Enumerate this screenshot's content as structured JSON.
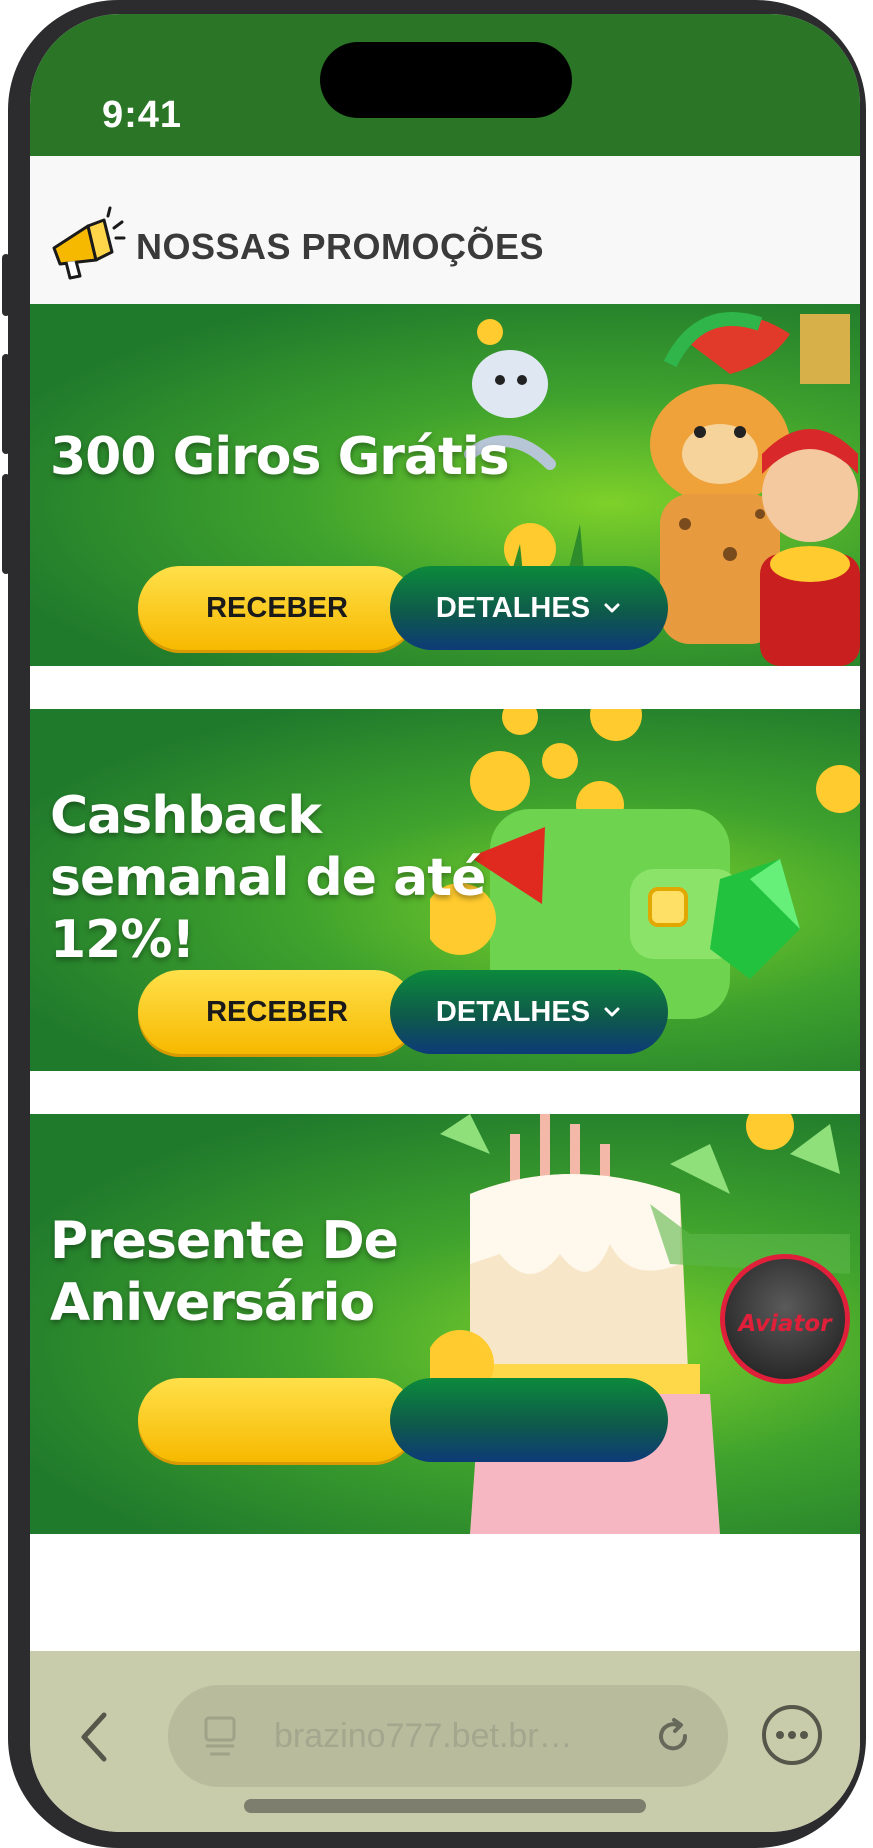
{
  "status_bar": {
    "time": "9:41"
  },
  "header": {
    "title": "NOSSAS PROMOÇÕES"
  },
  "promotions": [
    {
      "title_lines": [
        "300 Giros Grátis"
      ],
      "receive_label": "RECEBER",
      "details_label": "DETALHES"
    },
    {
      "title_lines": [
        "Cashback",
        "semanal de até",
        "12%!"
      ],
      "receive_label": "RECEBER",
      "details_label": "DETALHES"
    },
    {
      "title_lines": [
        "Presente De",
        "Aniversário"
      ]
    }
  ],
  "floating_game": {
    "label": "Aviator"
  },
  "browser": {
    "url": "brazino777.bet.br…"
  },
  "colors": {
    "status_bar": "#2a7526",
    "banner_green": "#3fa22d",
    "button_yellow": "#f7b900",
    "button_blue": "#0d3b78",
    "browser_bar": "#c9ccab"
  },
  "icons": [
    "megaphone-icon",
    "chevron-down-icon",
    "back-chevron-icon",
    "tabs-icon",
    "reload-icon",
    "more-icon"
  ]
}
